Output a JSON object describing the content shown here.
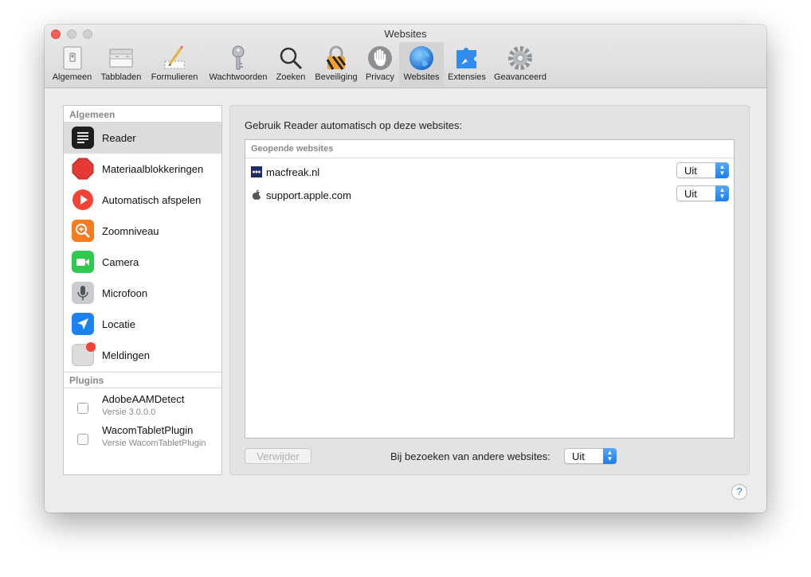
{
  "window": {
    "title": "Websites"
  },
  "toolbar": {
    "items": [
      {
        "label": "Algemeen",
        "icon": "general-icon"
      },
      {
        "label": "Tabbladen",
        "icon": "tabs-icon"
      },
      {
        "label": "Formulieren",
        "icon": "forms-pencil-icon"
      },
      {
        "label": "Wachtwoorden",
        "icon": "key-icon"
      },
      {
        "label": "Zoeken",
        "icon": "search-icon"
      },
      {
        "label": "Beveiliging",
        "icon": "padlock-icon"
      },
      {
        "label": "Privacy",
        "icon": "hand-icon"
      },
      {
        "label": "Websites",
        "icon": "globe-icon",
        "active": true
      },
      {
        "label": "Extensies",
        "icon": "puzzle-compass-icon"
      },
      {
        "label": "Geavanceerd",
        "icon": "gear-icon"
      }
    ]
  },
  "sidebar": {
    "general_header": "Algemeen",
    "items": [
      {
        "label": "Reader",
        "icon": "reader-icon",
        "color": "#1e1e1e",
        "selected": true
      },
      {
        "label": "Materiaalblokkeringen",
        "icon": "stop-sign-icon",
        "color": "#e53935"
      },
      {
        "label": "Automatisch afspelen",
        "icon": "play-icon",
        "color": "#f44336"
      },
      {
        "label": "Zoomniveau",
        "icon": "zoom-icon",
        "color": "#f57c1f"
      },
      {
        "label": "Camera",
        "icon": "camera-icon",
        "color": "#2fc94d"
      },
      {
        "label": "Microfoon",
        "icon": "microphone-icon",
        "color": "#c8ccd0"
      },
      {
        "label": "Locatie",
        "icon": "location-arrow-icon",
        "color": "#1b82f0"
      },
      {
        "label": "Meldingen",
        "icon": "notification-icon",
        "color": "#dcdcdc"
      }
    ],
    "plugins_header": "Plugins",
    "plugins": [
      {
        "name": "AdobeAAMDetect",
        "version": "Versie 3.0.0.0"
      },
      {
        "name": "WacomTabletPlugin",
        "version": "Versie WacomTabletPlugin"
      }
    ]
  },
  "main": {
    "heading": "Gebruik Reader automatisch op deze websites:",
    "table_header": "Geopende websites",
    "sites": [
      {
        "name": "macfreak.nl",
        "icon": "macfreak-favicon-icon",
        "value": "Uit"
      },
      {
        "name": "support.apple.com",
        "icon": "apple-logo-icon",
        "value": "Uit"
      }
    ],
    "remove_button": "Verwijder",
    "other_label": "Bij bezoeken van andere websites:",
    "other_value": "Uit"
  },
  "help": {
    "label": "?"
  },
  "colors": {
    "accent": "#1a7ff0",
    "stop": "#e53935",
    "notification_badge": "#f44336"
  }
}
